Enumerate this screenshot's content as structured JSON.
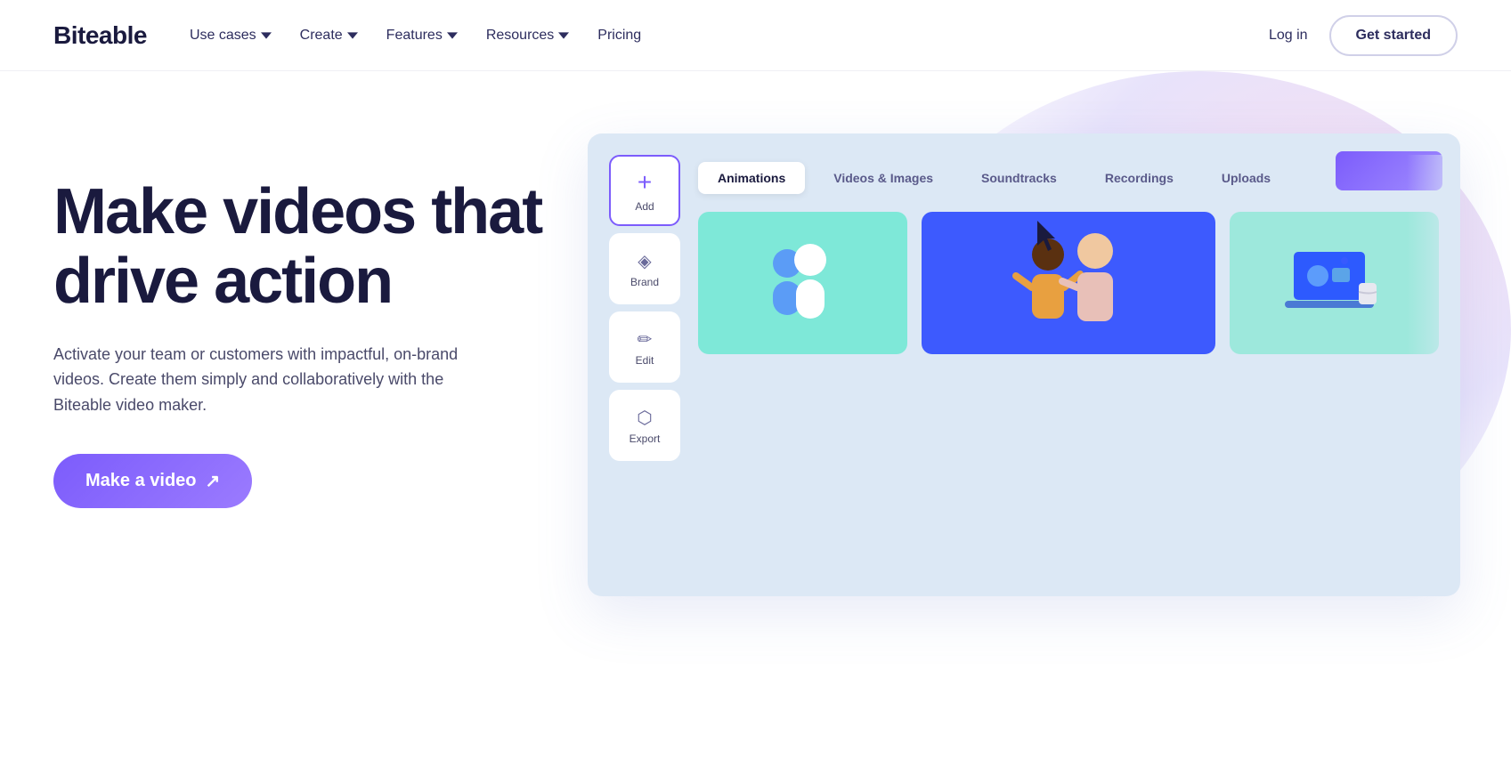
{
  "nav": {
    "logo": "Biteable",
    "links": [
      {
        "label": "Use cases",
        "hasDropdown": true
      },
      {
        "label": "Create",
        "hasDropdown": true
      },
      {
        "label": "Features",
        "hasDropdown": true
      },
      {
        "label": "Resources",
        "hasDropdown": true
      },
      {
        "label": "Pricing",
        "hasDropdown": false
      }
    ],
    "login": "Log in",
    "get_started": "Get started"
  },
  "hero": {
    "title_line1": "Make videos that",
    "title_line2": "drive action",
    "description": "Activate your team or customers with impactful, on-brand videos. Create them simply and collaboratively with the Biteable video maker.",
    "cta_label": "Make a video"
  },
  "mockup": {
    "sidebar_items": [
      {
        "icon": "＋",
        "label": "Add",
        "active": true
      },
      {
        "icon": "◈",
        "label": "Brand",
        "active": false
      },
      {
        "icon": "✏",
        "label": "Edit",
        "active": false
      },
      {
        "icon": "↗",
        "label": "Export",
        "active": false
      }
    ],
    "tabs": [
      {
        "label": "Animations",
        "active": true
      },
      {
        "label": "Videos & Images",
        "active": false
      },
      {
        "label": "Soundtracks",
        "active": false
      },
      {
        "label": "Recordings",
        "active": false
      },
      {
        "label": "Uploads",
        "active": false
      }
    ]
  }
}
